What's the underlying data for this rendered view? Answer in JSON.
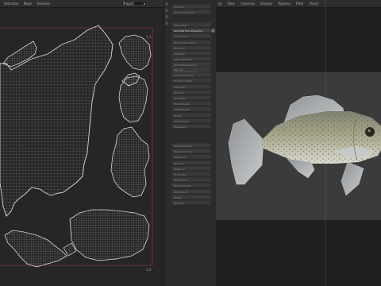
{
  "uv_editor": {
    "menu": [
      "Selection",
      "Maps",
      "Textures"
    ],
    "project_select": "Project",
    "corner_labels": {
      "top_right": "1,1",
      "bottom_right": "1,0"
    }
  },
  "command_panel": {
    "buttons": [
      {
        "label": "Lock UV",
        "hi": false
      },
      {
        "label": "Unwrap UV Chart",
        "hi": false
      },
      {
        "label": "Planar Map",
        "hi": false
      },
      {
        "label": "Set UVW from Projection",
        "hi": true
      },
      {
        "label": "UV Smooth",
        "hi": false
      },
      {
        "label": "UV Smooth Interior",
        "hi": false
      },
      {
        "label": "UV Mirror",
        "hi": false
      },
      {
        "label": "UV Relax",
        "hi": false
      },
      {
        "label": "Interpolate Map",
        "hi": false
      },
      {
        "label": "UV Dilate Snapping",
        "hi": false
      },
      {
        "label": "UV Rescale Mapping",
        "hi": false
      },
      {
        "label": "Map UV",
        "hi": false
      },
      {
        "label": "UV Mirror Points",
        "hi": false
      },
      {
        "label": "UV Mirror Mesh",
        "hi": false
      },
      {
        "label": "Symmetry",
        "hi": false
      },
      {
        "label": "Align UV",
        "hi": false
      },
      {
        "label": "Lock Ratio",
        "hi": false
      },
      {
        "label": "UV Rectangle",
        "hi": false
      },
      {
        "label": "UV Relaxation",
        "hi": false
      },
      {
        "label": "UV Pin",
        "hi": false
      },
      {
        "label": "Orient Island",
        "hi": false
      },
      {
        "label": "Straighten",
        "hi": false
      },
      {
        "label": "Unwrap to Grid",
        "hi": false
      },
      {
        "label": "Rescale to Grid",
        "hi": false
      },
      {
        "label": "Shape UV",
        "hi": false
      },
      {
        "label": "Pack UV",
        "hi": false
      },
      {
        "label": "Stack UV",
        "hi": false
      },
      {
        "label": "Fit UV Tile",
        "hi": false
      },
      {
        "label": "Fit UV Tiles",
        "hi": false
      },
      {
        "label": "Flip Horizontal",
        "hi": false
      },
      {
        "label": "Flip Vertical",
        "hi": false
      },
      {
        "label": "Rotate",
        "hi": false
      },
      {
        "label": "Straight",
        "hi": false
      }
    ]
  },
  "viewport": {
    "menu": [
      "View",
      "Cameras",
      "Display",
      "Options",
      "Filter",
      "Panel"
    ]
  },
  "colors": {
    "uv_line": "#9a9a9a",
    "uv_boundary": "#d8d8d8",
    "tile_border": "#b13a3a",
    "fish_body": "#a7a58a",
    "viewport_panel": "#3b3b3b"
  }
}
